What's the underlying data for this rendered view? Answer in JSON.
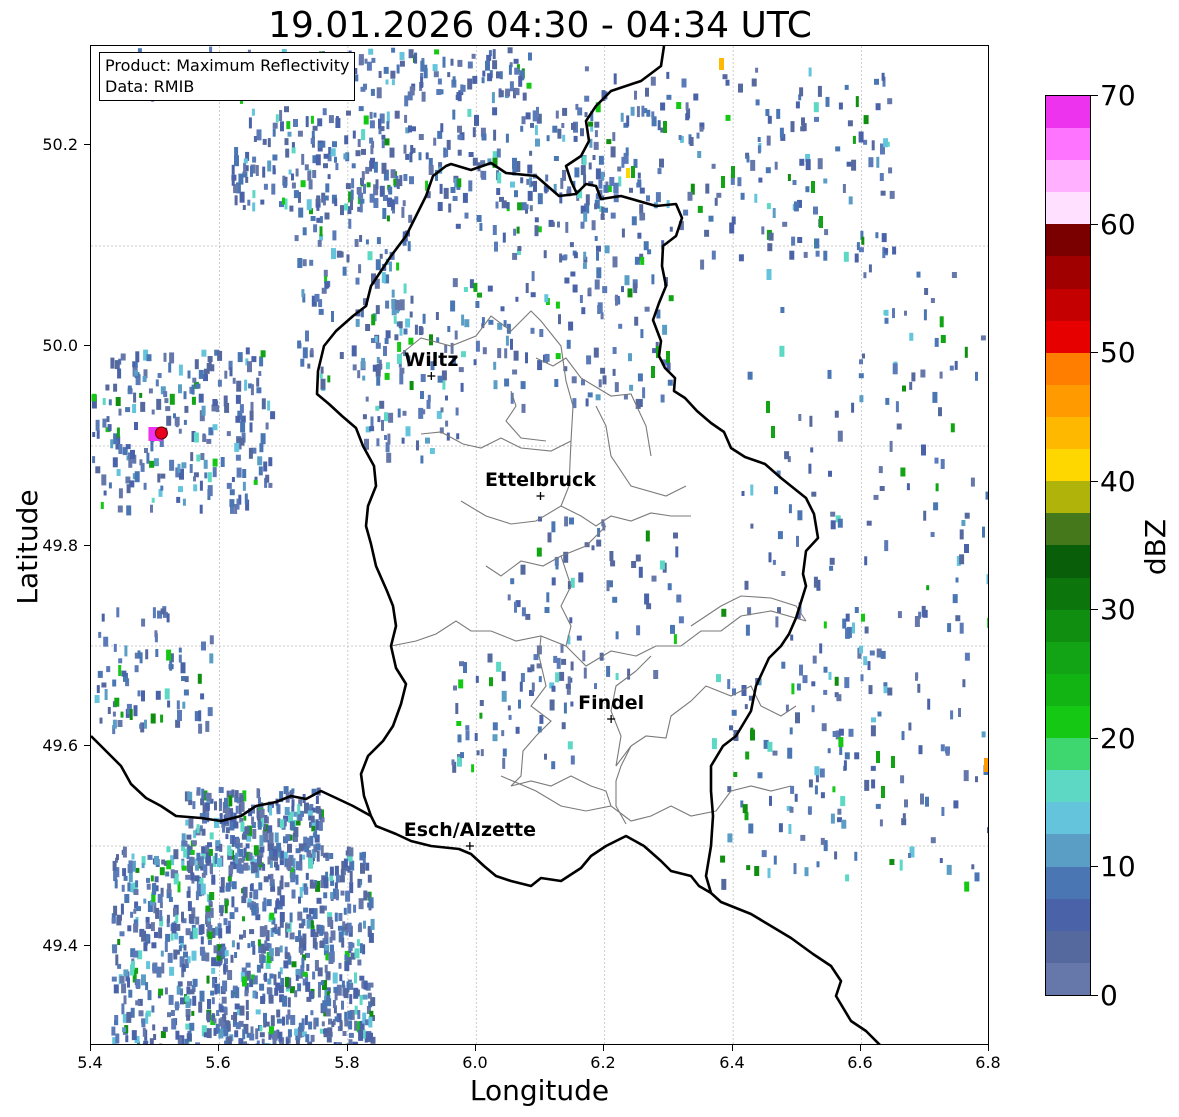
{
  "title": "19.01.2026 04:30 - 04:34 UTC",
  "info": {
    "product": "Product: Maximum Reflectivity",
    "source": "Data: RMIB"
  },
  "axes": {
    "xlabel": "Longitude",
    "ylabel": "Latitude",
    "xlim": [
      5.4,
      6.8
    ],
    "ylim": [
      49.3,
      50.3
    ],
    "xticks": [
      "5.4",
      "5.6",
      "5.8",
      "6.0",
      "6.2",
      "6.4",
      "6.6",
      "6.8"
    ],
    "yticks": [
      "49.4",
      "49.6",
      "49.8",
      "50.0",
      "50.2"
    ],
    "grid": "on (dotted grey)"
  },
  "colorbar": {
    "label": "dBZ",
    "range": [
      0,
      70
    ],
    "ticks": [
      "0",
      "10",
      "20",
      "30",
      "40",
      "50",
      "60",
      "70"
    ],
    "colors": [
      "#6677aa",
      "#56699f",
      "#4a62a8",
      "#4a77b4",
      "#5a9ec6",
      "#64c4dc",
      "#5cd8c4",
      "#3ed66e",
      "#14c814",
      "#12b414",
      "#12a414",
      "#0f8e0f",
      "#0c760c",
      "#095e09",
      "#45781a",
      "#b0b30a",
      "#ffd700",
      "#ffb800",
      "#ff9a00",
      "#ff7e00",
      "#e60000",
      "#c40000",
      "#a00000",
      "#7a0000",
      "#ffe0ff",
      "#ffb0ff",
      "#ff74ff",
      "#ee33ee"
    ]
  },
  "places": [
    {
      "name": "Wiltz",
      "lon": 5.93,
      "lat": 49.97
    },
    {
      "name": "Ettelbruck",
      "lon": 6.1,
      "lat": 49.85
    },
    {
      "name": "Findel",
      "lon": 6.21,
      "lat": 49.627
    },
    {
      "name": "Esch/Alzette",
      "lon": 5.99,
      "lat": 49.5
    }
  ],
  "radar_site": {
    "lon": 5.505,
    "lat": 49.915
  }
}
